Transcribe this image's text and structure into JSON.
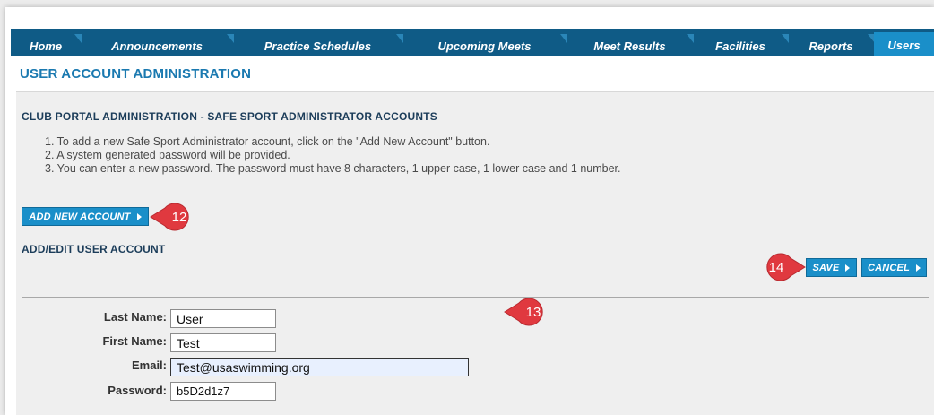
{
  "nav": {
    "tabs": [
      {
        "label": "Home",
        "active": false
      },
      {
        "label": "Announcements",
        "active": false
      },
      {
        "label": "Practice Schedules",
        "active": false
      },
      {
        "label": "Upcoming Meets",
        "active": false
      },
      {
        "label": "Meet Results",
        "active": false
      },
      {
        "label": "Facilities",
        "active": false
      },
      {
        "label": "Reports",
        "active": false
      },
      {
        "label": "Users",
        "active": true
      }
    ]
  },
  "page": {
    "title": "USER ACCOUNT ADMINISTRATION"
  },
  "section": {
    "title": "CLUB PORTAL ADMINISTRATION - SAFE SPORT ADMINISTRATOR ACCOUNTS",
    "instructions": [
      "1. To add a new Safe Sport Administrator account, click on the \"Add New Account\" button.",
      "2. A system generated password will be provided.",
      "3. You can enter a new password. The password must have 8 characters, 1 upper case, 1 lower case and 1 number."
    ],
    "add_button": "ADD NEW ACCOUNT"
  },
  "form": {
    "title": "ADD/EDIT USER ACCOUNT",
    "save_button": "SAVE",
    "cancel_button": "CANCEL",
    "fields": {
      "last_name": {
        "label": "Last Name:",
        "value": "User"
      },
      "first_name": {
        "label": "First Name:",
        "value": "Test"
      },
      "email": {
        "label": "Email:",
        "value": "Test@usaswimming.org"
      },
      "password": {
        "label": "Password:",
        "value": "b5D2d1z7"
      }
    }
  },
  "callouts": [
    {
      "number": "12"
    },
    {
      "number": "13"
    },
    {
      "number": "14"
    }
  ],
  "colors": {
    "nav_bg": "#0f5b86",
    "accent": "#1a8fc9",
    "title_blue": "#1a79b0",
    "callout_red": "#e0393f"
  }
}
